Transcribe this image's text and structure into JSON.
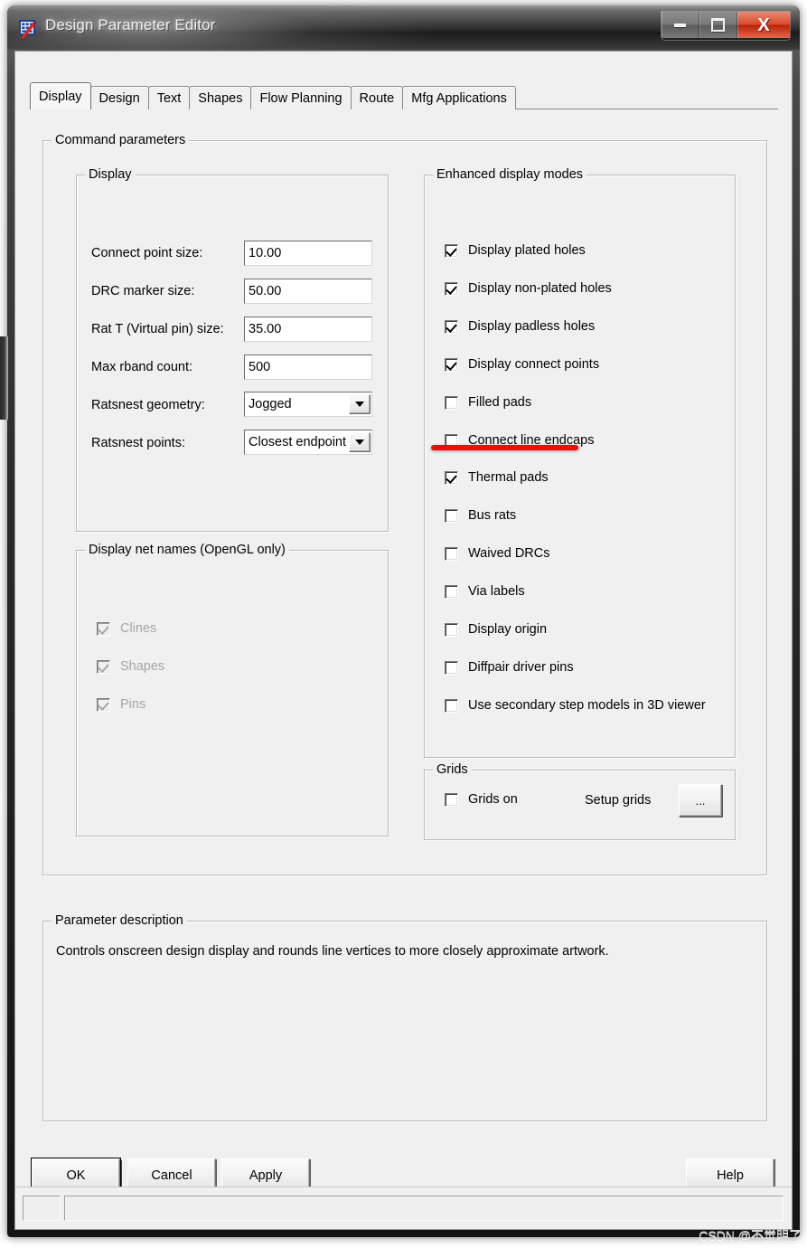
{
  "window": {
    "title": "Design Parameter Editor",
    "icon": "app-icon",
    "buttons": {
      "minimize": "minimize-icon",
      "maximize": "maximize-icon",
      "close": "X"
    }
  },
  "tabs": [
    {
      "label": "Display",
      "active": true
    },
    {
      "label": "Design",
      "active": false
    },
    {
      "label": "Text",
      "active": false
    },
    {
      "label": "Shapes",
      "active": false
    },
    {
      "label": "Flow Planning",
      "active": false
    },
    {
      "label": "Route",
      "active": false
    },
    {
      "label": "Mfg Applications",
      "active": false
    }
  ],
  "command_parameters": {
    "legend": "Command parameters",
    "display_group": {
      "legend": "Display",
      "fields": [
        {
          "label": "Connect point size:",
          "value": "10.00",
          "type": "text"
        },
        {
          "label": "DRC marker size:",
          "value": "50.00",
          "type": "text"
        },
        {
          "label": "Rat T (Virtual pin) size:",
          "value": "35.00",
          "type": "text"
        },
        {
          "label": "Max rband count:",
          "value": "500",
          "type": "text"
        },
        {
          "label": "Ratsnest geometry:",
          "value": "Jogged",
          "type": "combo"
        },
        {
          "label": "Ratsnest points:",
          "value": "Closest endpoint",
          "type": "combo"
        }
      ]
    },
    "net_names_group": {
      "legend": "Display net names (OpenGL only)",
      "items": [
        {
          "label": "Clines",
          "checked": true,
          "disabled": true
        },
        {
          "label": "Shapes",
          "checked": true,
          "disabled": true
        },
        {
          "label": "Pins",
          "checked": true,
          "disabled": true
        }
      ]
    },
    "enhanced_group": {
      "legend": "Enhanced display modes",
      "items": [
        {
          "label": "Display plated holes",
          "checked": true
        },
        {
          "label": "Display non-plated holes",
          "checked": true
        },
        {
          "label": "Display padless holes",
          "checked": true
        },
        {
          "label": "Display connect points",
          "checked": true
        },
        {
          "label": "Filled pads",
          "checked": false
        },
        {
          "label": "Connect line endcaps",
          "checked": false,
          "annotated": true
        },
        {
          "label": "Thermal pads",
          "checked": true
        },
        {
          "label": "Bus rats",
          "checked": false
        },
        {
          "label": "Waived DRCs",
          "checked": false
        },
        {
          "label": "Via labels",
          "checked": false
        },
        {
          "label": "Display origin",
          "checked": false
        },
        {
          "label": "Diffpair driver pins",
          "checked": false
        },
        {
          "label": "Use secondary step models in 3D viewer",
          "checked": false
        }
      ]
    },
    "grids_group": {
      "legend": "Grids",
      "grids_on_label": "Grids on",
      "grids_on_checked": false,
      "setup_grids_label": "Setup grids",
      "setup_grids_button": "..."
    }
  },
  "parameter_description": {
    "legend": "Parameter description",
    "text": "Controls onscreen design display and rounds line vertices to more closely approximate artwork."
  },
  "dialog_buttons": {
    "ok": "OK",
    "cancel": "Cancel",
    "apply": "Apply",
    "help": "Help"
  },
  "statusbar": {
    "left_pane": "",
    "main_pane": ""
  },
  "watermark": "CSDN @不觉明了",
  "colors": {
    "dialog_bg": "#f0f0f0",
    "annotation_red": "#f10a0a",
    "close_button_red": "#d9492c",
    "title_text": "#efefef"
  }
}
